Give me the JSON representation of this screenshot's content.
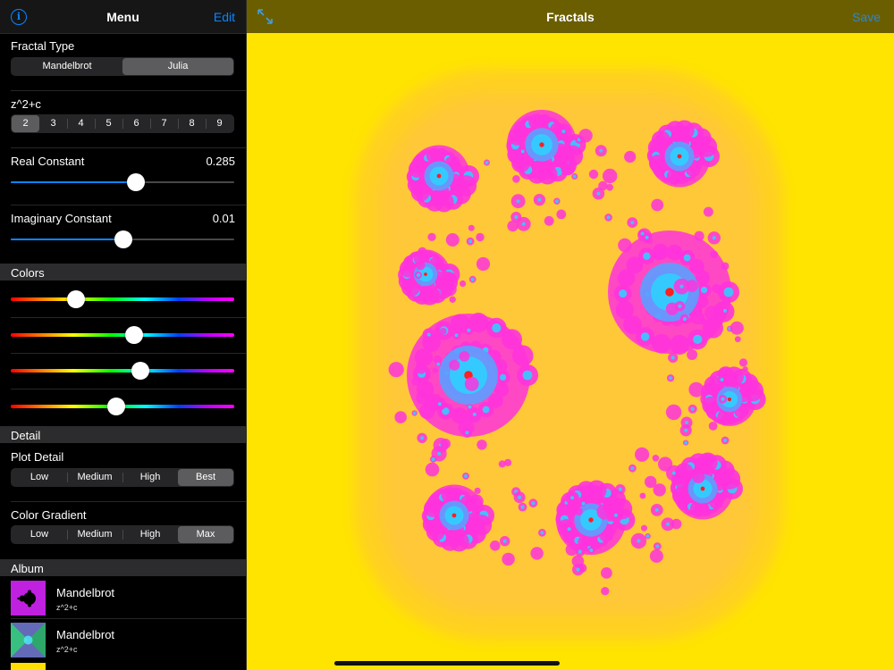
{
  "sidebar": {
    "title": "Menu",
    "edit_label": "Edit",
    "info_icon": "info-circle-icon",
    "fractal_type": {
      "label": "Fractal Type",
      "options": [
        "Mandelbrot",
        "Julia"
      ],
      "selected": "Julia"
    },
    "formula": {
      "label": "z^2+c",
      "options": [
        "2",
        "3",
        "4",
        "5",
        "6",
        "7",
        "8",
        "9"
      ],
      "selected": "2"
    },
    "real_constant": {
      "label": "Real Constant",
      "value": "0.285",
      "fraction": 0.56
    },
    "imaginary_constant": {
      "label": "Imaginary Constant",
      "value": "0.01",
      "fraction": 0.505
    },
    "colors": {
      "header": "Colors",
      "slider_fractions": [
        0.29,
        0.55,
        0.58,
        0.47
      ]
    },
    "detail": {
      "header": "Detail",
      "plot_detail": {
        "label": "Plot Detail",
        "options": [
          "Low",
          "Medium",
          "High",
          "Best"
        ],
        "selected": "Best"
      },
      "color_gradient": {
        "label": "Color Gradient",
        "options": [
          "Low",
          "Medium",
          "High",
          "Max"
        ],
        "selected": "Max"
      }
    },
    "album": {
      "header": "Album",
      "items": [
        {
          "name": "Mandelbrot",
          "formula": "z^2+c"
        },
        {
          "name": "Mandelbrot",
          "formula": "z^2+c"
        }
      ]
    }
  },
  "main": {
    "title": "Fractals",
    "save_label": "Save",
    "expand_icon": "expand-arrows-icon"
  },
  "colors": {
    "accent": "#0a84ff",
    "fractal_background": "#ffe400",
    "fractal_pink": "#ff33dd",
    "fractal_cyan": "#33ccff"
  }
}
